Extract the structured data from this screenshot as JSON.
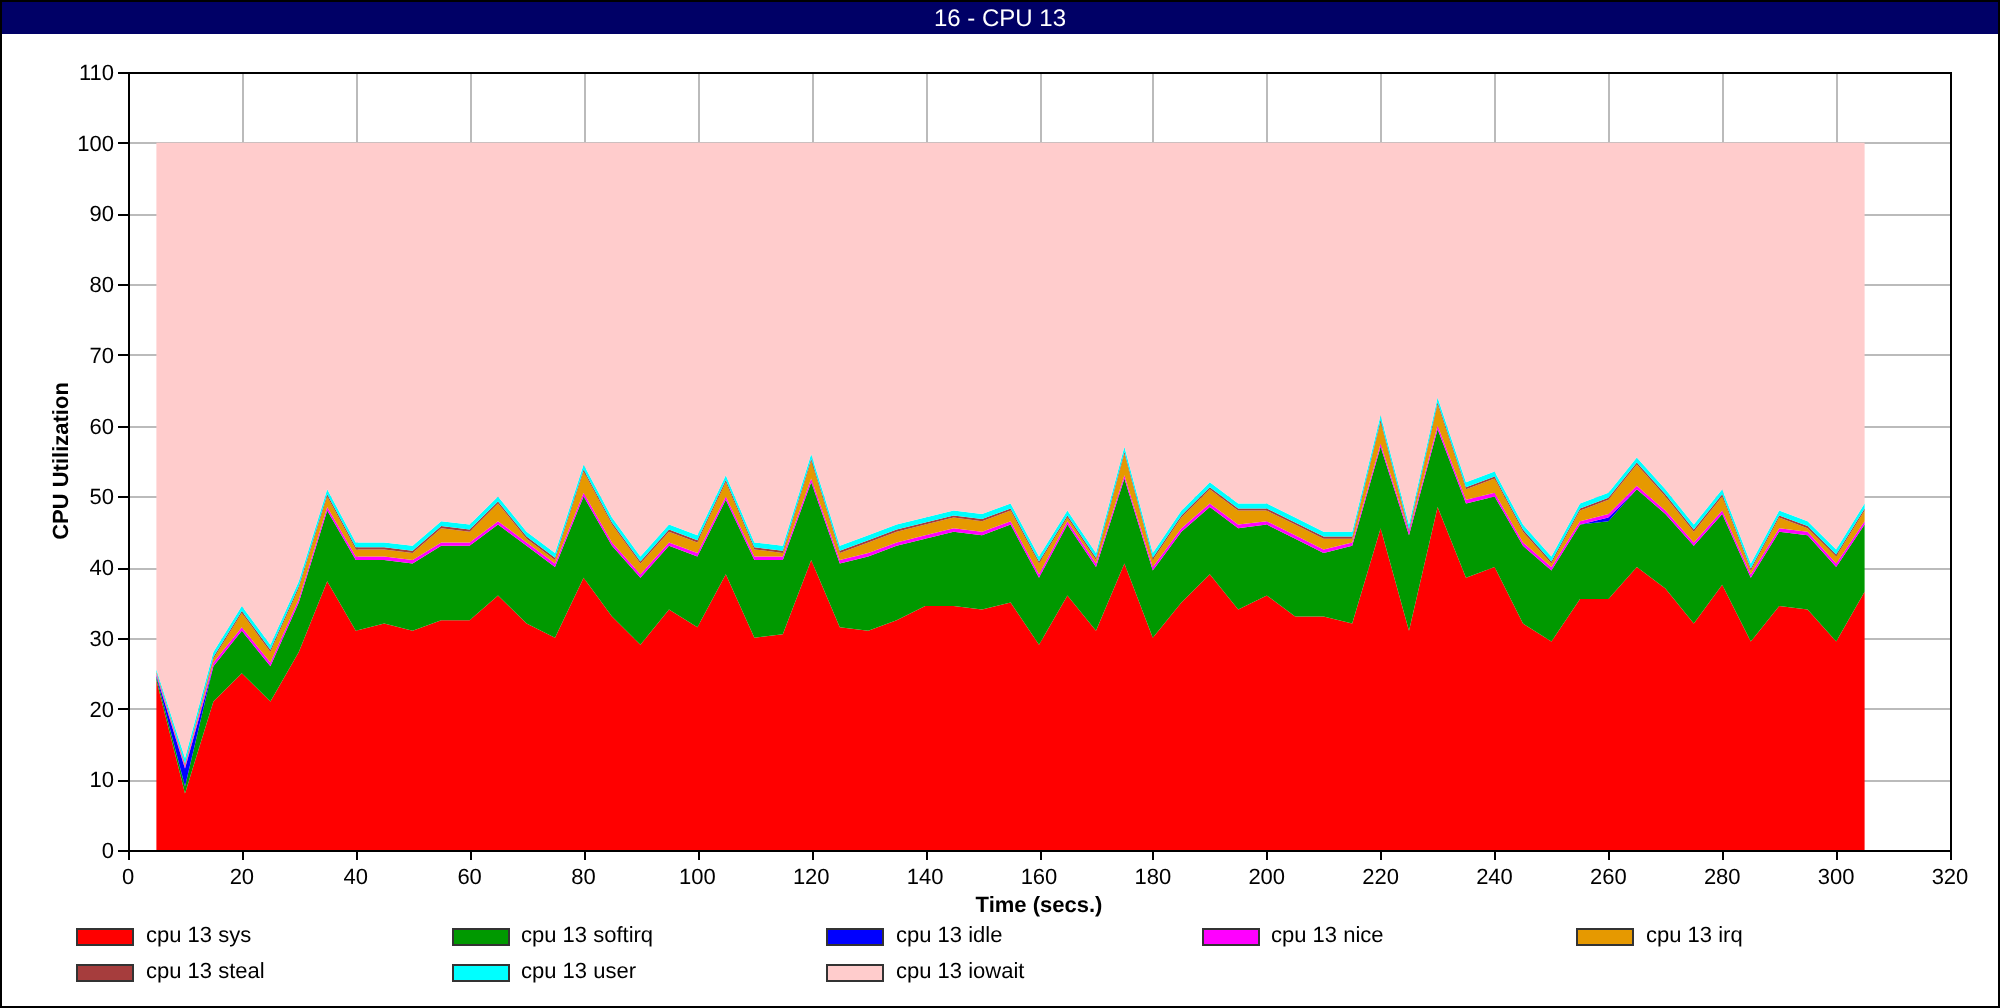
{
  "window": {
    "title": "16 - CPU 13"
  },
  "chart_data": {
    "type": "area",
    "stacked": true,
    "grid": true,
    "xlabel": "Time (secs.)",
    "ylabel": "CPU Utilization",
    "xlim": [
      0,
      320
    ],
    "ylim": [
      0,
      110
    ],
    "xticks": [
      0,
      20,
      40,
      60,
      80,
      100,
      120,
      140,
      160,
      180,
      200,
      220,
      240,
      260,
      280,
      300,
      320
    ],
    "yticks": [
      0,
      10,
      20,
      30,
      40,
      50,
      60,
      70,
      80,
      90,
      100,
      110
    ],
    "x": [
      5,
      10,
      15,
      20,
      25,
      30,
      35,
      40,
      45,
      50,
      55,
      60,
      65,
      70,
      75,
      80,
      85,
      90,
      95,
      100,
      105,
      110,
      115,
      120,
      125,
      130,
      135,
      140,
      145,
      150,
      155,
      160,
      165,
      170,
      175,
      180,
      185,
      190,
      195,
      200,
      205,
      210,
      215,
      220,
      225,
      230,
      235,
      240,
      245,
      250,
      255,
      260,
      265,
      270,
      275,
      280,
      285,
      290,
      295,
      300,
      305
    ],
    "series": [
      {
        "name": "cpu 13 sys",
        "color": "#ff0000",
        "values": [
          24,
          8,
          21,
          25,
          21,
          28,
          38,
          31,
          32,
          31,
          32.5,
          32.5,
          36,
          32,
          30,
          38.5,
          33,
          29,
          34,
          31.5,
          39,
          30,
          30.5,
          41,
          31.5,
          31,
          32.5,
          34.5,
          34.5,
          34,
          35,
          29,
          36,
          31,
          40.5,
          30,
          35,
          39,
          34,
          36,
          33,
          33,
          32,
          45.5,
          31,
          48.5,
          38.5,
          40,
          32,
          29.5,
          35.5,
          35.5,
          40,
          37,
          32,
          37.5,
          29.5,
          34.5,
          34,
          29.5,
          36.5
        ]
      },
      {
        "name": "cpu 13 softirq",
        "color": "#009900",
        "values": [
          0.5,
          1,
          5,
          6,
          5,
          7,
          10,
          10,
          9,
          9.5,
          10.5,
          10.5,
          10,
          11,
          10,
          11.5,
          10,
          9.5,
          9,
          10,
          10.5,
          11,
          10.5,
          11,
          9,
          10.5,
          10.5,
          9.5,
          10.5,
          10.5,
          11,
          9.5,
          10,
          9,
          12,
          9.5,
          10,
          9.5,
          11.5,
          10,
          11,
          9,
          11,
          11.5,
          13.5,
          11,
          10.5,
          10,
          11,
          10,
          10.5,
          11,
          11,
          10.5,
          11,
          10,
          9,
          10.5,
          10.5,
          10.5,
          9.5
        ]
      },
      {
        "name": "cpu 13 idle",
        "color": "#0000ff",
        "values": [
          0.2,
          2.5,
          0,
          0,
          0,
          0,
          0,
          0,
          0,
          0,
          0,
          0,
          0,
          0,
          0,
          0,
          0,
          0,
          0,
          0,
          0,
          0,
          0,
          0,
          0,
          0,
          0,
          0,
          0,
          0,
          0,
          0,
          0,
          0,
          0,
          0,
          0,
          0,
          0,
          0,
          0,
          0,
          0,
          0,
          0,
          0,
          0,
          0,
          0,
          0,
          0,
          0.5,
          0,
          0,
          0,
          0,
          0,
          0,
          0,
          0,
          0
        ]
      },
      {
        "name": "cpu 13 nice",
        "color": "#ff00ff",
        "values": [
          0.2,
          0.3,
          0.5,
          0.5,
          0.5,
          0.5,
          0.5,
          0.5,
          0.5,
          0.5,
          0.5,
          0.5,
          0.5,
          0.5,
          0.5,
          0.5,
          0.5,
          0.5,
          0.5,
          0.5,
          0.5,
          0.5,
          0.5,
          0.5,
          0.5,
          0.5,
          0.5,
          0.5,
          0.5,
          0.5,
          0.5,
          0.5,
          0.5,
          0.5,
          0.5,
          0.5,
          0.5,
          0.5,
          0.5,
          0.5,
          0.5,
          0.5,
          0.5,
          0.5,
          0.5,
          0.5,
          0.5,
          0.5,
          0.5,
          0.5,
          0.5,
          0.5,
          0.5,
          0.5,
          0.5,
          0.5,
          0.5,
          0.5,
          0.5,
          0.5,
          0.5
        ]
      },
      {
        "name": "cpu 13 irq",
        "color": "#e69900",
        "values": [
          0.2,
          0.2,
          0.5,
          2,
          1.5,
          1.5,
          1.5,
          1,
          1,
          1,
          2,
          1.5,
          2.5,
          0.5,
          0.5,
          3,
          2.5,
          1.5,
          1.5,
          1.5,
          2,
          1,
          0.5,
          2.5,
          1,
          1.5,
          1.5,
          1.5,
          1.5,
          1.5,
          1.5,
          1.5,
          0.5,
          0.5,
          3,
          1,
          1.5,
          2,
          2,
          1.5,
          1.5,
          1.5,
          0.5,
          3,
          0,
          3,
          1.5,
          2,
          1.5,
          0.5,
          1.5,
          2,
          3,
          2,
          1.5,
          2,
          0.5,
          1.5,
          0.5,
          1,
          1.5
        ]
      },
      {
        "name": "cpu 13 steal",
        "color": "#a63d3d",
        "values": [
          0.1,
          0.2,
          0.3,
          0.3,
          0.3,
          0.3,
          0.3,
          0.3,
          0.3,
          0.3,
          0.3,
          0.3,
          0.3,
          0.3,
          0.3,
          0.3,
          0.3,
          0.3,
          0.3,
          0.3,
          0.3,
          0.3,
          0.3,
          0.3,
          0.3,
          0.3,
          0.3,
          0.3,
          0.3,
          0.3,
          0.3,
          0.3,
          0.3,
          0.3,
          0.3,
          0.3,
          0.3,
          0.3,
          0.3,
          0.3,
          0.3,
          0.3,
          0.3,
          0.3,
          0.3,
          0.3,
          0.3,
          0.3,
          0.3,
          0.3,
          0.3,
          0.3,
          0.3,
          0.3,
          0.3,
          0.3,
          0.3,
          0.3,
          0.3,
          0.3,
          0.3
        ]
      },
      {
        "name": "cpu 13 user",
        "color": "#00ffff",
        "values": [
          0.3,
          0.8,
          0.7,
          0.7,
          0.7,
          0.7,
          0.7,
          0.7,
          0.7,
          0.7,
          0.7,
          0.7,
          0.7,
          0.7,
          0.7,
          0.7,
          0.7,
          0.7,
          0.7,
          0.7,
          0.7,
          0.7,
          0.7,
          0.7,
          0.7,
          0.7,
          0.7,
          0.7,
          0.7,
          0.7,
          0.7,
          0.7,
          0.7,
          0.7,
          0.7,
          0.7,
          0.7,
          0.7,
          0.7,
          0.7,
          0.7,
          0.7,
          0.7,
          0.7,
          0.7,
          0.7,
          0.7,
          0.7,
          0.7,
          0.7,
          0.7,
          0.7,
          0.7,
          0.7,
          0.7,
          0.7,
          0.7,
          0.7,
          0.7,
          0.7,
          0.7
        ]
      },
      {
        "name": "cpu 13 iowait",
        "color": "#ffcccc",
        "values": [
          74.5,
          87,
          72,
          65.5,
          71,
          62,
          49,
          56.5,
          56.5,
          57,
          53.5,
          54,
          50,
          55,
          58,
          45.5,
          53,
          58.5,
          54,
          55.5,
          47,
          56.5,
          57,
          44,
          57,
          55.5,
          54,
          53,
          52,
          52.5,
          51,
          58.5,
          52,
          58,
          43,
          58,
          52,
          48,
          51,
          51,
          53,
          55,
          55,
          38.5,
          54,
          36,
          48,
          46.5,
          54,
          58.5,
          51,
          49.5,
          44.5,
          49,
          54,
          49,
          59.5,
          52,
          53.5,
          57.5,
          51
        ]
      }
    ]
  }
}
